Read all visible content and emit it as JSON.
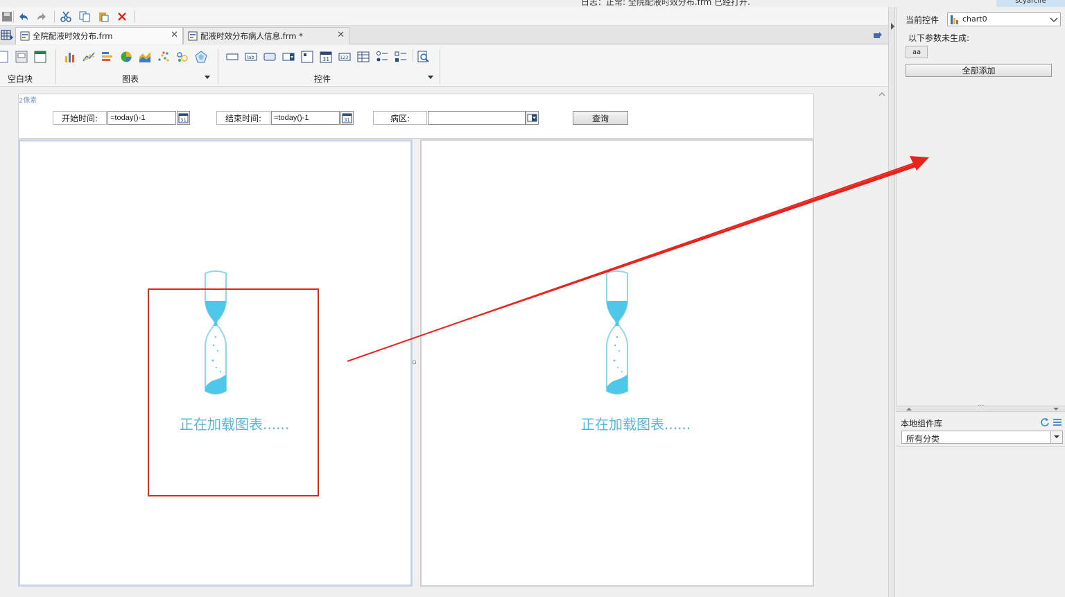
{
  "status": {
    "message": "日志：正常: 全院配液时效分布.frm 已经打开.",
    "user": "scyarcife"
  },
  "tabs": [
    {
      "label": "全院配液时效分布.frm",
      "active": true
    },
    {
      "label": "配液时效分布病人信息.frm *",
      "active": false
    }
  ],
  "ribbon": {
    "groups": [
      "空白块",
      "图表",
      "控件"
    ]
  },
  "params": {
    "ruler_label": "2像素",
    "start_label": "开始时间:",
    "start_value": "=today()-1",
    "end_label": "结束时间:",
    "end_value": "=today()-1",
    "ward_label": "病区:",
    "ward_value": "",
    "query_label": "查询"
  },
  "charts": [
    {
      "loading_text": "正在加载图表......"
    },
    {
      "loading_text": "正在加载图表......"
    }
  ],
  "right_panel": {
    "current_control_label": "当前控件",
    "current_control_value": "chart0",
    "ungenerated_label": "以下参数未生成:",
    "param_tag": "aa",
    "add_all_label": "全部添加",
    "library_title": "本地组件库",
    "category_value": "所有分类"
  },
  "colors": {
    "annotation_red": "#e8231c",
    "hourglass_cyan": "#4dc8e8",
    "loading_text": "#5ab7d7"
  }
}
